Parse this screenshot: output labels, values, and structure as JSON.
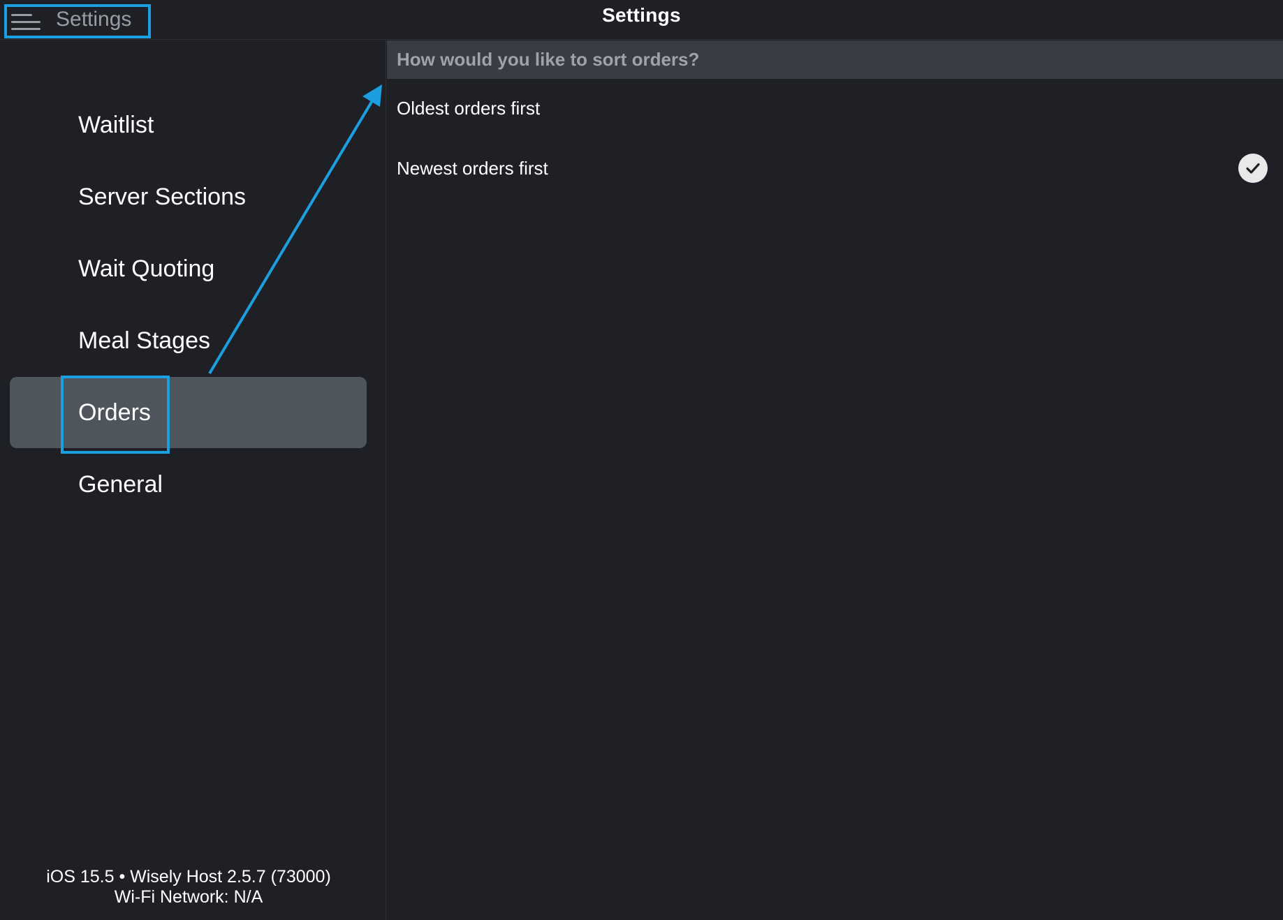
{
  "header": {
    "title": "Settings",
    "menu_label": "Settings"
  },
  "sidebar": {
    "items": [
      {
        "label": "Waitlist"
      },
      {
        "label": "Server Sections"
      },
      {
        "label": "Wait Quoting"
      },
      {
        "label": "Meal Stages"
      },
      {
        "label": "Orders",
        "selected": true
      },
      {
        "label": "General"
      }
    ],
    "footer_line1": "iOS 15.5 • Wisely Host 2.5.7 (73000)",
    "footer_line2": "Wi-Fi Network: N/A"
  },
  "main": {
    "question": "How would you like to sort orders?",
    "options": [
      {
        "label": "Oldest orders first",
        "selected": false
      },
      {
        "label": "Newest orders first",
        "selected": true
      }
    ]
  },
  "colors": {
    "background": "#1f2025",
    "selected_item": "#4f555c",
    "annotation": "#1b9fe0",
    "section_header": "#3a3c44"
  },
  "icons": [
    "hamburger-icon",
    "checkmark-icon"
  ]
}
